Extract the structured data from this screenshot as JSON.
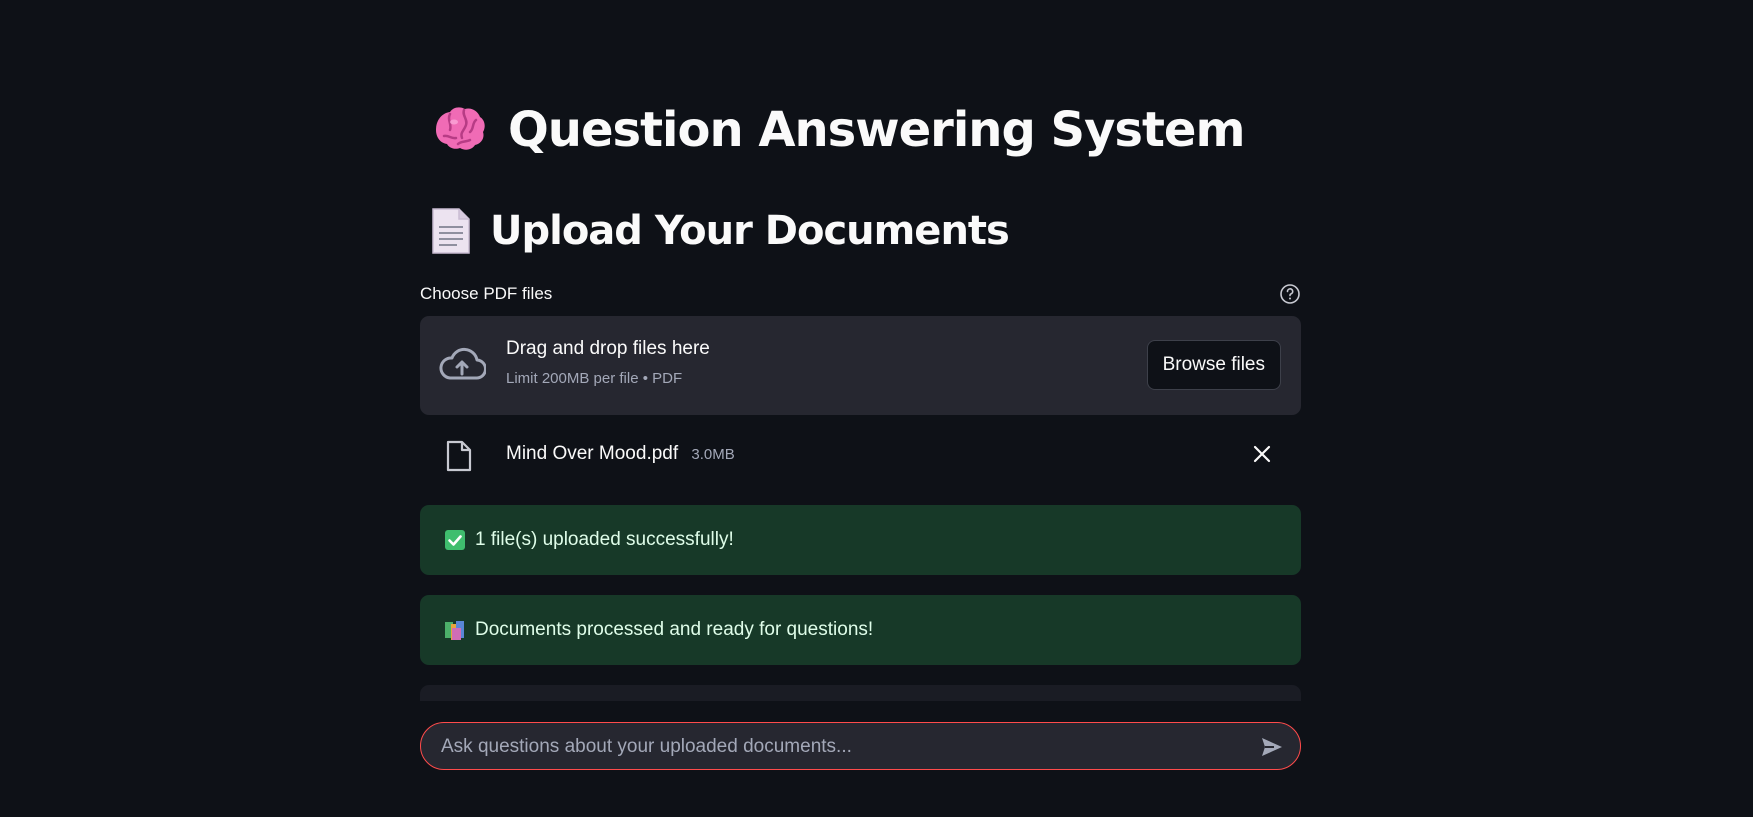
{
  "app": {
    "title": "Question Answering System",
    "title_icon": "brain-icon"
  },
  "upload_section": {
    "heading": "Upload Your Documents",
    "heading_icon": "page-document-icon",
    "label": "Choose PDF files",
    "help_icon": "help-circle-icon",
    "dropzone": {
      "icon": "cloud-upload-icon",
      "title": "Drag and drop files here",
      "subtitle": "Limit 200MB per file • PDF",
      "browse_label": "Browse files"
    },
    "files": [
      {
        "name": "Mind Over Mood.pdf",
        "size": "3.0MB",
        "icon": "file-icon",
        "remove_icon": "close-icon"
      }
    ]
  },
  "alerts": [
    {
      "icon": "check-box-icon",
      "text": "1 file(s) uploaded successfully!"
    },
    {
      "icon": "books-icon",
      "text": "Documents processed and ready for questions!"
    }
  ],
  "chat": {
    "placeholder": "Ask questions about your uploaded documents...",
    "send_icon": "send-icon"
  },
  "colors": {
    "background": "#0e1117",
    "panel": "#262730",
    "success_bg": "#173928",
    "success_text": "#dffde9",
    "accent": "#ff4b4b",
    "muted_text": "#a3a8b8"
  }
}
